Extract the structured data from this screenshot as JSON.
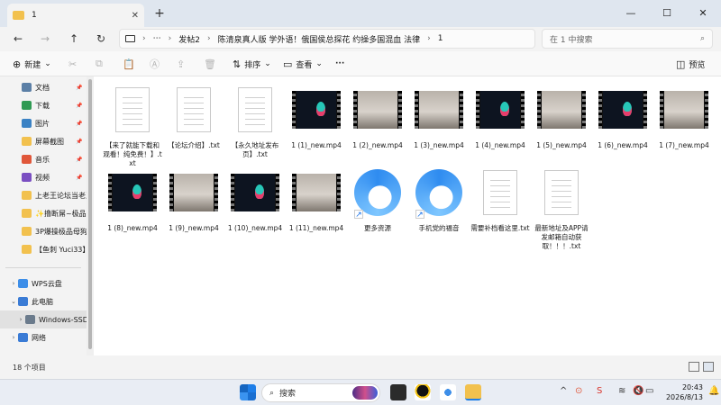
{
  "window": {
    "tab_label": "1",
    "tab_close": "✕",
    "new_tab": "+",
    "minimize": "—",
    "maximize": "☐",
    "close": "✕"
  },
  "address": {
    "more": "⋯",
    "crumbs": [
      "发帖2",
      "陈清泉真人版 学外语！俄国侯总探花 约操多国混血 法律",
      "1"
    ],
    "separator": "›",
    "search_placeholder": "在 1 中搜索",
    "search_icon": "⌕"
  },
  "toolbar": {
    "new_label": "新建",
    "sort_label": "排序",
    "view_label": "查看",
    "more_label": "···",
    "preview_label": "预览"
  },
  "sidebar": {
    "items": [
      {
        "label": "文档",
        "icon": "documents-icon",
        "color": "#5b7fa6",
        "pinned": true
      },
      {
        "label": "下载",
        "icon": "download-icon",
        "color": "#2f9a53",
        "pinned": true
      },
      {
        "label": "图片",
        "icon": "pictures-icon",
        "color": "#3b82c4",
        "pinned": true
      },
      {
        "label": "屏幕截图",
        "icon": "folder-icon",
        "color": "#f2c14e",
        "pinned": true
      },
      {
        "label": "音乐",
        "icon": "music-icon",
        "color": "#e0573a",
        "pinned": true
      },
      {
        "label": "视频",
        "icon": "video-icon",
        "color": "#7a4fc2",
        "pinned": true
      },
      {
        "label": "上老王论坛当老王",
        "icon": "folder-icon",
        "color": "#f2c14e",
        "pinned": false
      },
      {
        "label": "✨撸断屌~极品",
        "icon": "folder-icon",
        "color": "#f2c14e",
        "pinned": false
      },
      {
        "label": "3P爆操极品母狗",
        "icon": "folder-icon",
        "color": "#f2c14e",
        "pinned": false
      },
      {
        "label": "【鱼刺 Yuci33】",
        "icon": "folder-icon",
        "color": "#f2c14e",
        "pinned": false
      }
    ],
    "drives": [
      {
        "label": "WPS云盘",
        "icon": "cloud-icon",
        "color": "#3d8ee8",
        "expandable": true
      },
      {
        "label": "此电脑",
        "icon": "computer-icon",
        "color": "#3a7bd5",
        "expandable": true,
        "expanded": true
      },
      {
        "label": "Windows-SSD",
        "icon": "drive-icon",
        "color": "#6b7b8c",
        "expandable": true,
        "selected": true
      },
      {
        "label": "网络",
        "icon": "network-icon",
        "color": "#3a7bd5",
        "expandable": true
      }
    ],
    "pin_glyph": "📌"
  },
  "files": [
    {
      "name": "【来了就能下载和观看！纯免费！】.txt",
      "kind": "txt"
    },
    {
      "name": "【论坛介绍】.txt",
      "kind": "txt"
    },
    {
      "name": "【永久地址发布页】.txt",
      "kind": "txt"
    },
    {
      "name": "1 (1)_new.mp4",
      "kind": "video-dark"
    },
    {
      "name": "1 (2)_new.mp4",
      "kind": "video-room"
    },
    {
      "name": "1 (3)_new.mp4",
      "kind": "video-room"
    },
    {
      "name": "1 (4)_new.mp4",
      "kind": "video-dark"
    },
    {
      "name": "1 (5)_new.mp4",
      "kind": "video-room"
    },
    {
      "name": "1 (6)_new.mp4",
      "kind": "video-dark"
    },
    {
      "name": "1 (7)_new.mp4",
      "kind": "video-room"
    },
    {
      "name": "1 (8)_new.mp4",
      "kind": "video-dark"
    },
    {
      "name": "1 (9)_new.mp4",
      "kind": "video-room"
    },
    {
      "name": "1 (10)_new.mp4",
      "kind": "video-dark"
    },
    {
      "name": "1 (11)_new.mp4",
      "kind": "video-room"
    },
    {
      "name": "更多资源",
      "kind": "shortcut"
    },
    {
      "name": "手机党的福音",
      "kind": "shortcut"
    },
    {
      "name": "需要补档看这里.txt",
      "kind": "txt"
    },
    {
      "name": "最新地址及APP请发邮箱自动获取！！！.txt",
      "kind": "txt"
    }
  ],
  "status": {
    "count": "18 个项目"
  },
  "taskbar": {
    "search_label": "搜索",
    "tray_chevron": "^",
    "time": "20:43",
    "date": "2026/8/13"
  }
}
